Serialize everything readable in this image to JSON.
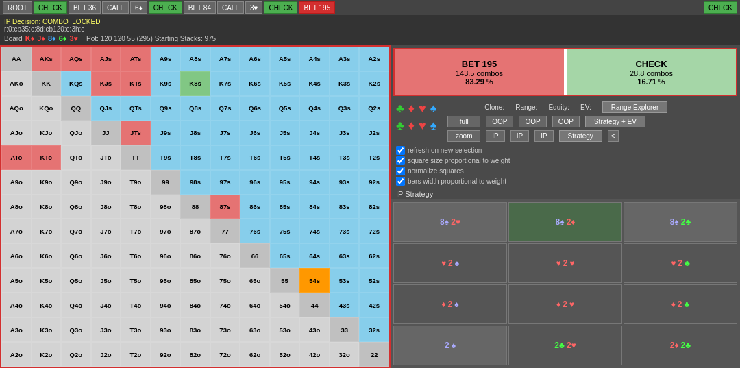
{
  "topbar": {
    "buttons": [
      {
        "label": "ROOT",
        "style": "normal"
      },
      {
        "label": "CHECK",
        "style": "active-green"
      },
      {
        "label": "BET 36",
        "style": "normal"
      },
      {
        "label": "CALL",
        "style": "normal"
      },
      {
        "label": "6♦",
        "style": "normal"
      },
      {
        "label": "CHECK",
        "style": "active-green"
      },
      {
        "label": "BET 84",
        "style": "normal"
      },
      {
        "label": "CALL",
        "style": "normal"
      },
      {
        "label": "3♥",
        "style": "normal"
      },
      {
        "label": "CHECK",
        "style": "active-green"
      },
      {
        "label": "BET 195",
        "style": "active-red"
      },
      {
        "label": "CHECK",
        "style": "active-green"
      }
    ]
  },
  "info": {
    "ip_decision": "IP Decision: COMBO_LOCKED",
    "path": "r:0:cb35:c:8d:cb120:c:3h:c",
    "board_label": "Board",
    "board_cards": [
      "K♦",
      "J♦",
      "8♦",
      "6♦",
      "3♥"
    ],
    "pot": "Pot: 120 120 55 (295) Starting Stacks: 975"
  },
  "actions": {
    "bet": {
      "label": "BET 195",
      "combos": "143.5 combos",
      "pct": "83.29 %"
    },
    "check": {
      "label": "CHECK",
      "combos": "28.8 combos",
      "pct": "16.71 %"
    }
  },
  "controls": {
    "clone_label": "Clone:",
    "range_label": "Range:",
    "equity_label": "Equity:",
    "ev_label": "EV:",
    "range_explorer_btn": "Range Explorer",
    "full_btn": "full",
    "oop_range_btn": "OOP",
    "oop_equity_btn": "OOP",
    "oop_ev_btn": "OOP",
    "strategy_ev_btn": "Strategy + EV",
    "zoom_btn": "zoom",
    "ip_range_btn": "IP",
    "ip_equity_btn": "IP",
    "ip_ev_btn": "IP",
    "strategy_btn": "Strategy",
    "arrow_btn": "<"
  },
  "checkboxes": {
    "refresh": "refresh on new selection",
    "square_size": "square size proportional to weight",
    "normalize": "normalize squares",
    "bars_width": "bars width proportional to weight"
  },
  "ip_strategy": "IP Strategy",
  "grid": {
    "headers": [
      "AA",
      "AKs",
      "AQs",
      "AJs",
      "ATs",
      "A9s",
      "A8s",
      "A7s",
      "A6s",
      "A5s",
      "A4s",
      "A3s",
      "A2s"
    ],
    "rows": [
      [
        "AA",
        "AKs",
        "AQs",
        "AJs",
        "ATs",
        "A9s",
        "A8s",
        "A7s",
        "A6s",
        "A5s",
        "A4s",
        "A3s",
        "A2s"
      ],
      [
        "AKo",
        "KK",
        "KQs",
        "KJs",
        "KTs",
        "K9s",
        "K8s",
        "K7s",
        "K6s",
        "K5s",
        "K4s",
        "K3s",
        "K2s"
      ],
      [
        "AQo",
        "KQo",
        "QQ",
        "QJs",
        "QTs",
        "Q9s",
        "Q8s",
        "Q7s",
        "Q6s",
        "Q5s",
        "Q4s",
        "Q3s",
        "Q2s"
      ],
      [
        "AJo",
        "KJo",
        "QJo",
        "JJ",
        "JTs",
        "J9s",
        "J8s",
        "J7s",
        "J6s",
        "J5s",
        "J4s",
        "J3s",
        "J2s"
      ],
      [
        "ATo",
        "KTo",
        "QTo",
        "JTo",
        "TT",
        "T9s",
        "T8s",
        "T7s",
        "T6s",
        "T5s",
        "T4s",
        "T3s",
        "T2s"
      ],
      [
        "A9o",
        "K9o",
        "Q9o",
        "J9o",
        "T9o",
        "99",
        "98s",
        "97s",
        "96s",
        "95s",
        "94s",
        "93s",
        "92s"
      ],
      [
        "A8o",
        "K8o",
        "Q8o",
        "J8o",
        "T8o",
        "98o",
        "88",
        "87s",
        "86s",
        "85s",
        "84s",
        "83s",
        "82s"
      ],
      [
        "A7o",
        "K7o",
        "Q7o",
        "J7o",
        "T7o",
        "97o",
        "87o",
        "77",
        "76s",
        "75s",
        "74s",
        "73s",
        "72s"
      ],
      [
        "A6o",
        "K6o",
        "Q6o",
        "J6o",
        "T6o",
        "96o",
        "86o",
        "76o",
        "66",
        "65s",
        "64s",
        "63s",
        "62s"
      ],
      [
        "A5o",
        "K5o",
        "Q5o",
        "J5o",
        "T5o",
        "95o",
        "85o",
        "75o",
        "65o",
        "55",
        "54s",
        "53s",
        "52s"
      ],
      [
        "A4o",
        "K4o",
        "Q4o",
        "J4o",
        "T4o",
        "94o",
        "84o",
        "74o",
        "64o",
        "54o",
        "44",
        "43s",
        "42s"
      ],
      [
        "A3o",
        "K3o",
        "Q3o",
        "J3o",
        "T3o",
        "93o",
        "83o",
        "73o",
        "63o",
        "53o",
        "43o",
        "33",
        "32s"
      ],
      [
        "A2o",
        "K2o",
        "Q2o",
        "J2o",
        "T2o",
        "92o",
        "82o",
        "72o",
        "62o",
        "52o",
        "42o",
        "32o",
        "22"
      ]
    ],
    "colors": [
      [
        "pair",
        "red",
        "red",
        "red",
        "red",
        "gray",
        "gray",
        "gray",
        "gray",
        "gray",
        "gray",
        "gray",
        "gray"
      ],
      [
        "gray",
        "pair",
        "gray",
        "red",
        "red",
        "gray",
        "green",
        "gray",
        "gray",
        "gray",
        "gray",
        "gray",
        "gray"
      ],
      [
        "gray",
        "gray",
        "pair",
        "gray",
        "gray",
        "gray",
        "gray",
        "gray",
        "gray",
        "gray",
        "gray",
        "gray",
        "gray"
      ],
      [
        "gray",
        "gray",
        "gray",
        "pair",
        "red",
        "gray",
        "gray",
        "gray",
        "gray",
        "gray",
        "gray",
        "gray",
        "gray"
      ],
      [
        "red",
        "red",
        "gray",
        "gray",
        "pair",
        "gray",
        "gray",
        "gray",
        "gray",
        "gray",
        "gray",
        "gray",
        "gray"
      ],
      [
        "gray",
        "gray",
        "gray",
        "gray",
        "gray",
        "pair",
        "gray",
        "gray",
        "gray",
        "gray",
        "gray",
        "gray",
        "gray"
      ],
      [
        "gray",
        "gray",
        "gray",
        "gray",
        "gray",
        "gray",
        "pair",
        "red",
        "gray",
        "gray",
        "gray",
        "gray",
        "gray"
      ],
      [
        "gray",
        "gray",
        "gray",
        "gray",
        "gray",
        "gray",
        "gray",
        "pair",
        "gray",
        "gray",
        "gray",
        "gray",
        "gray"
      ],
      [
        "gray",
        "gray",
        "gray",
        "gray",
        "gray",
        "gray",
        "gray",
        "gray",
        "pair",
        "gray",
        "gray",
        "gray",
        "gray"
      ],
      [
        "gray",
        "gray",
        "gray",
        "gray",
        "gray",
        "gray",
        "gray",
        "gray",
        "gray",
        "pair",
        "orange",
        "gray",
        "gray"
      ],
      [
        "gray",
        "gray",
        "gray",
        "gray",
        "gray",
        "gray",
        "gray",
        "gray",
        "gray",
        "gray",
        "pair",
        "gray",
        "gray"
      ],
      [
        "gray",
        "gray",
        "gray",
        "gray",
        "gray",
        "gray",
        "gray",
        "gray",
        "gray",
        "gray",
        "gray",
        "pair",
        "gray"
      ],
      [
        "gray",
        "gray",
        "gray",
        "gray",
        "gray",
        "gray",
        "gray",
        "gray",
        "gray",
        "gray",
        "gray",
        "gray",
        "pair"
      ]
    ]
  },
  "card_cells": [
    [
      {
        "rank": "8♠",
        "suit2": "2♥",
        "color1": "black",
        "color2": "red"
      },
      {
        "rank": "8♠",
        "suit2": "2♦",
        "color1": "black",
        "color2": "red"
      },
      {
        "rank": "8♠",
        "suit2": "2♣",
        "color1": "black",
        "color2": "green"
      }
    ],
    [
      {
        "rank": "♥2♠",
        "color1": "red",
        "color2": "black",
        "empty": true
      },
      {
        "rank": "♥2♥",
        "color1": "red",
        "color2": "red",
        "empty": true
      },
      {
        "rank": "♥2♣",
        "color1": "red",
        "color2": "green",
        "empty": true
      }
    ],
    [
      {
        "rank": "♦2♠",
        "color1": "red",
        "color2": "black",
        "empty": true
      },
      {
        "rank": "♦2♥",
        "color1": "red",
        "color2": "red",
        "empty": true
      },
      {
        "rank": "♦2♣",
        "color1": "red",
        "color2": "green",
        "empty": true
      }
    ],
    [
      {
        "rank": "2♠",
        "color1": "black",
        "color2": "",
        "empty": false
      },
      {
        "rank": "2♣2♥",
        "color1": "green",
        "color2": "red",
        "empty": true
      },
      {
        "rank": "2♦2♣",
        "color1": "red",
        "color2": "green",
        "empty": true
      }
    ]
  ]
}
